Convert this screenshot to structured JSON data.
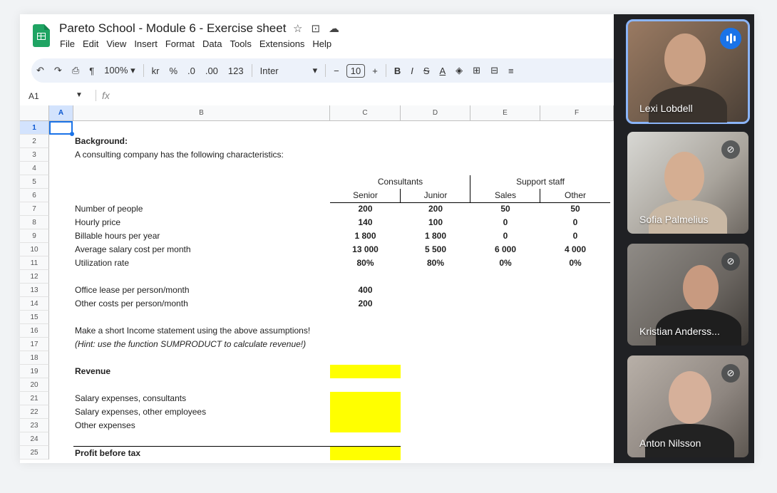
{
  "doc": {
    "title": "Pareto School - Module 6 -  Exercise sheet",
    "menu": [
      "File",
      "Edit",
      "View",
      "Insert",
      "Format",
      "Data",
      "Tools",
      "Extensions",
      "Help"
    ]
  },
  "toolbar": {
    "zoom": "100% ▾",
    "currency": "kr",
    "percent": "%",
    "dec_decrease": ".0",
    "dec_increase": ".00",
    "number_format": "123",
    "font": "Inter",
    "font_arrow": "▾",
    "minus": "−",
    "font_size": "10",
    "plus": "+",
    "bold": "B",
    "italic": "I",
    "strike": "S",
    "text_color": "A"
  },
  "formula_bar": {
    "name_box": "A1",
    "fx": "fx"
  },
  "columns": [
    {
      "label": "A",
      "selected": true
    },
    {
      "label": "B"
    },
    {
      "label": "C"
    },
    {
      "label": "D"
    },
    {
      "label": "E"
    },
    {
      "label": "F"
    }
  ],
  "rows": [
    "1",
    "2",
    "3",
    "4",
    "5",
    "6",
    "7",
    "8",
    "9",
    "10",
    "11",
    "12",
    "13",
    "14",
    "15",
    "16",
    "17",
    "18",
    "19",
    "20",
    "21",
    "22",
    "23",
    "24",
    "25"
  ],
  "sheet": {
    "background": "Background:",
    "intro": "A consulting company has the following characteristics:",
    "group_consultants": "Consultants",
    "group_support": "Support staff",
    "headers": [
      "Senior",
      "Junior",
      "Sales",
      "Other"
    ],
    "table": [
      {
        "label": "Number of people",
        "values": [
          "200",
          "200",
          "50",
          "50"
        ]
      },
      {
        "label": "Hourly price",
        "values": [
          "140",
          "100",
          "0",
          "0"
        ]
      },
      {
        "label": "Billable hours per year",
        "values": [
          "1 800",
          "1 800",
          "0",
          "0"
        ]
      },
      {
        "label": "Average salary cost per month",
        "values": [
          "13 000",
          "5 500",
          "6 000",
          "4 000"
        ]
      },
      {
        "label": "Utilization rate",
        "values": [
          "80%",
          "80%",
          "0%",
          "0%"
        ]
      }
    ],
    "office_lease": {
      "label": "Office lease per person/month",
      "value": "400"
    },
    "other_costs": {
      "label": "Other costs per person/month",
      "value": "200"
    },
    "instruction": "Make a short Income statement using the above assumptions!",
    "hint": "(Hint: use the function SUMPRODUCT to calculate revenue!)",
    "revenue": "Revenue",
    "sal_consultants": "Salary expenses, consultants",
    "sal_other": "Salary expenses, other employees",
    "other_expenses": "Other expenses",
    "profit": "Profit before tax",
    "highlight_color": "#ffff00"
  },
  "participants": [
    {
      "name": "Lexi Lobdell",
      "speaking": true
    },
    {
      "name": "Sofia Palmelius",
      "muted": true
    },
    {
      "name": "Kristian Anderss...",
      "muted": true
    },
    {
      "name": "Anton Nilsson",
      "muted": true
    }
  ]
}
